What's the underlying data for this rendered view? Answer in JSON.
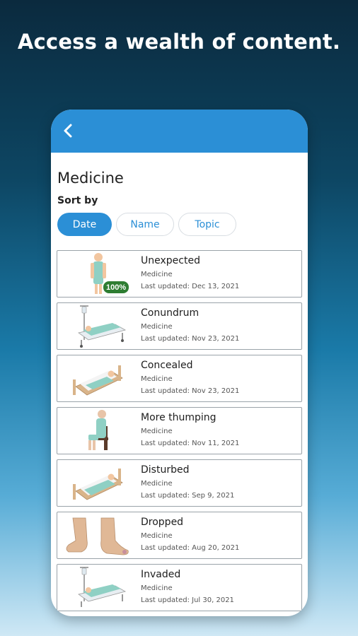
{
  "headline": "Access a wealth of content.",
  "colors": {
    "accent": "#2b8fd6",
    "badge": "#2e7d32"
  },
  "appbar": {
    "back_icon": "chevron-left-icon"
  },
  "page": {
    "title": "Medicine",
    "sort_label": "Sort by"
  },
  "sort_options": [
    {
      "label": "Date",
      "selected": true
    },
    {
      "label": "Name",
      "selected": false
    },
    {
      "label": "Topic",
      "selected": false
    }
  ],
  "items": [
    {
      "title": "Unexpected",
      "topic": "Medicine",
      "updated": "Last updated: Dec 13, 2021",
      "image": "standing-patient",
      "badge": "100%"
    },
    {
      "title": "Conundrum",
      "topic": "Medicine",
      "updated": "Last updated: Nov 23, 2021",
      "image": "patient-in-hospital-bed-iv"
    },
    {
      "title": "Concealed",
      "topic": "Medicine",
      "updated": "Last updated: Nov 23, 2021",
      "image": "patient-in-bed"
    },
    {
      "title": "More thumping",
      "topic": "Medicine",
      "updated": "Last updated: Nov 11, 2021",
      "image": "seated-patient"
    },
    {
      "title": "Disturbed",
      "topic": "Medicine",
      "updated": "Last updated: Sep 9, 2021",
      "image": "patient-in-bed"
    },
    {
      "title": "Dropped",
      "topic": "Medicine",
      "updated": "Last updated: Aug 20, 2021",
      "image": "feet"
    },
    {
      "title": "Invaded",
      "topic": "Medicine",
      "updated": "Last updated: Jul 30, 2021",
      "image": "patient-in-hospital-bed-iv"
    }
  ]
}
